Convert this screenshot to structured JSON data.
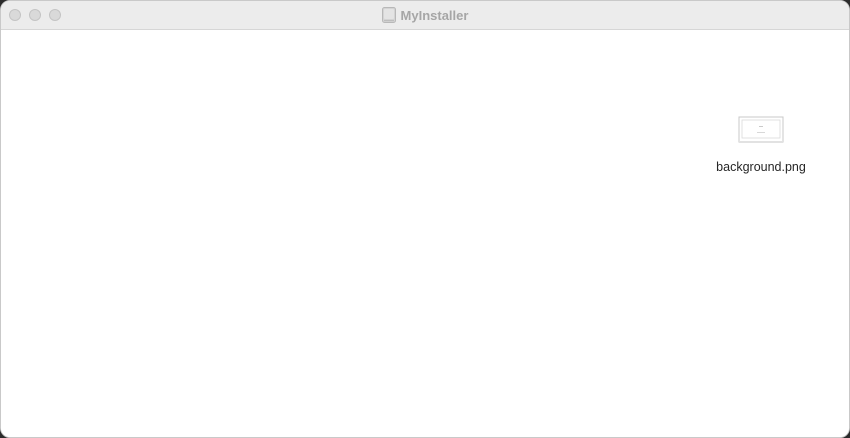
{
  "window": {
    "title": "MyInstaller",
    "title_icon": "disk-volume-icon"
  },
  "titlebar": {
    "controls": [
      "close-button",
      "minimize-button",
      "zoom-button"
    ]
  },
  "content": {
    "files": [
      {
        "name": "background.png",
        "icon": "image-file-icon"
      }
    ]
  },
  "colors": {
    "titlebar_bg": "#ececec",
    "title_text": "#a6a6a6",
    "content_bg": "#ffffff",
    "traffic_light_inactive": "#d9d9d9"
  }
}
